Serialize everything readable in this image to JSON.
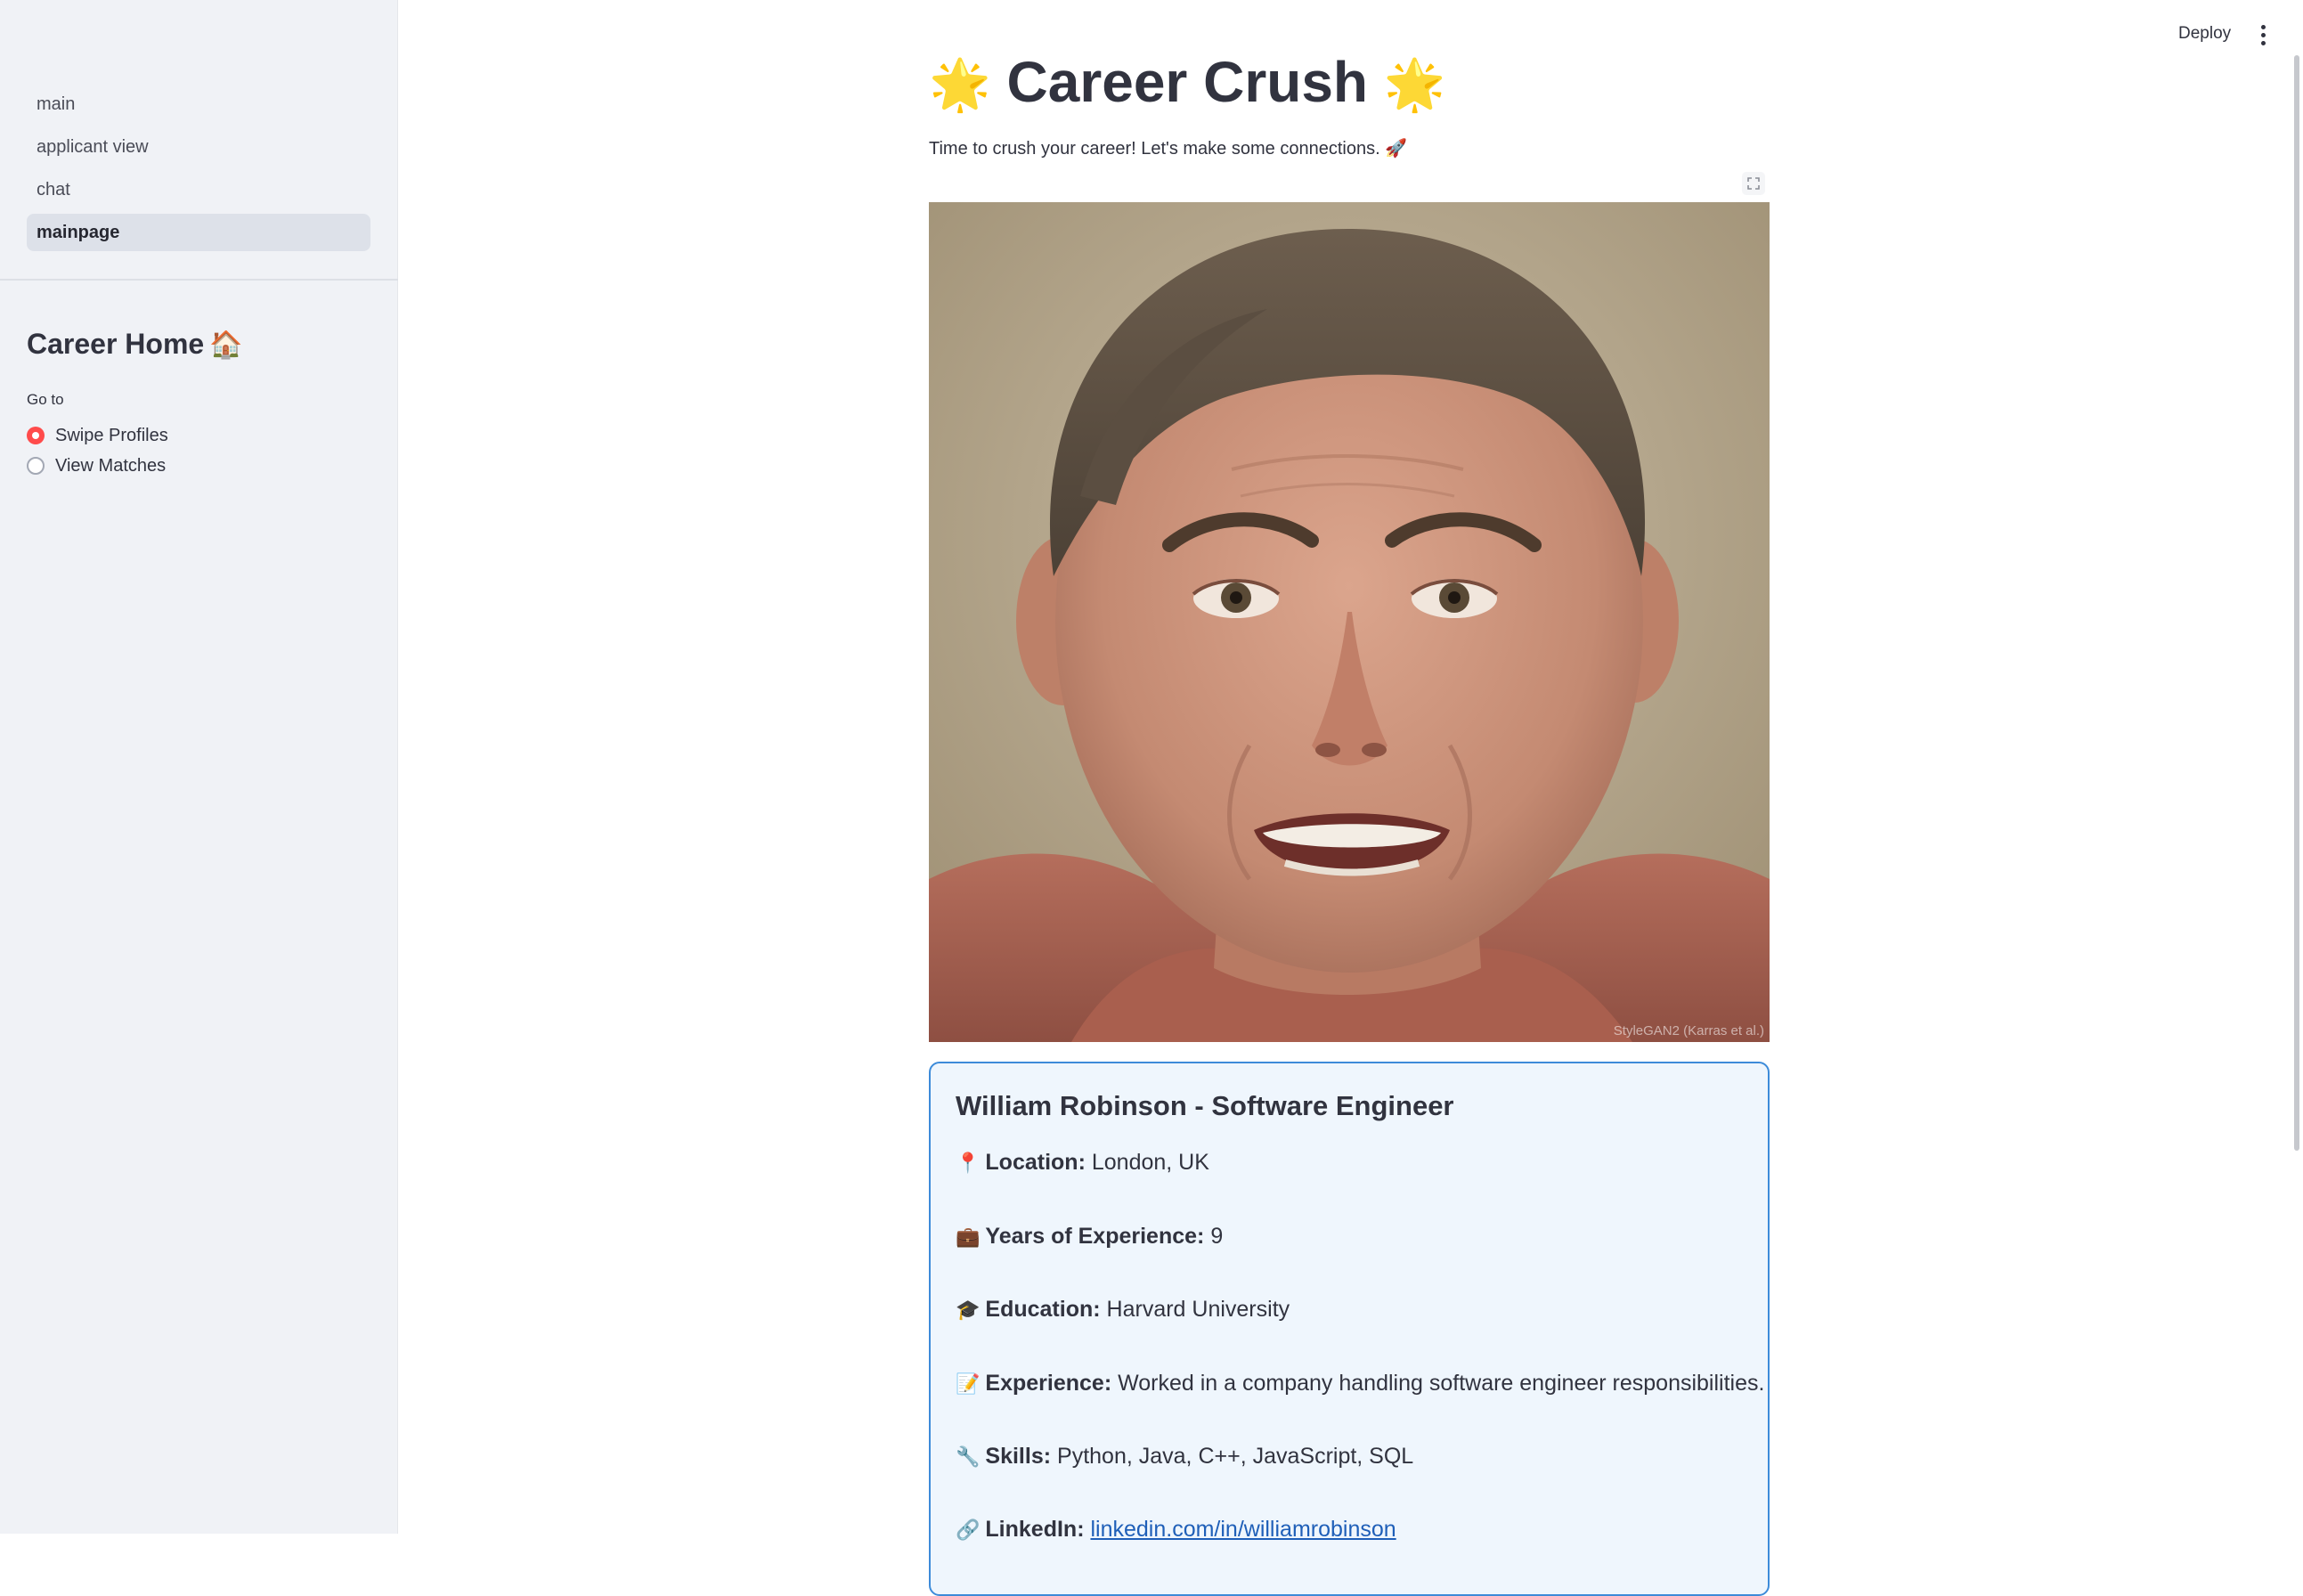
{
  "sidebar": {
    "nav": [
      "main",
      "applicant view",
      "chat",
      "mainpage"
    ],
    "section_title": "Career Home",
    "section_emoji": "🏠",
    "radio_label": "Go to",
    "options": [
      "Swipe Profiles",
      "View Matches"
    ],
    "selected": "Swipe Profiles"
  },
  "header": {
    "deploy_label": "Deploy"
  },
  "main": {
    "title_emoji": "🌟",
    "title": "Career Crush",
    "subtitle": "Time to crush your career! Let's make some connections. 🚀",
    "photo_credit": "StyleGAN2 (Karras et al.)"
  },
  "profile": {
    "name_title": "William Robinson - Software Engineer",
    "location_icon": "📍",
    "location_label": "Location:",
    "location": "London, UK",
    "years_icon": "💼",
    "years_label": "Years of Experience:",
    "years": "9",
    "education_icon": "🎓",
    "education_label": "Education:",
    "education": "Harvard University",
    "experience_icon": "📝",
    "experience_label": "Experience:",
    "experience": "Worked in a company handling software engineer responsibilities.",
    "skills_icon": "🔧",
    "skills_label": "Skills:",
    "skills": "Python, Java, C++, JavaScript, SQL",
    "linkedin_icon": "🔗",
    "linkedin_label": "LinkedIn:",
    "linkedin": "linkedin.com/in/williamrobinson"
  },
  "colors": {
    "sidebar_bg": "#f0f2f6",
    "accent": "#ff4b4b",
    "card_border": "#3d8bd9",
    "card_bg": "#eff6fd",
    "link": "#1f5fb8"
  }
}
